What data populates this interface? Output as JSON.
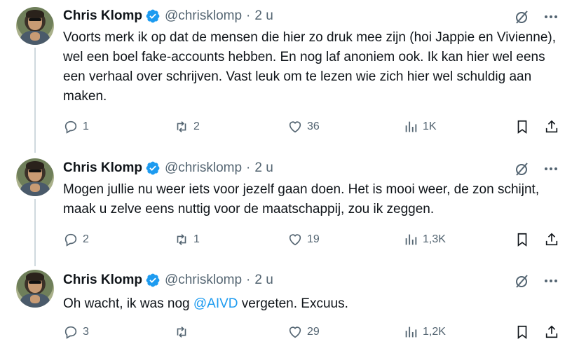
{
  "tweets": [
    {
      "name": "Chris Klomp",
      "handle": "@chrisklomp",
      "separator": "·",
      "time": "2 u",
      "text": "Voorts merk ik op dat de mensen die hier zo druk mee zijn (hoi Jappie en Vivienne), wel een boel fake-accounts hebben. En nog laf anoniem ook. Ik kan hier wel eens een verhaal over schrijven. Vast leuk om te lezen wie zich hier wel schuldig aan maken.",
      "text_before_mention": "",
      "mention": "",
      "text_after_mention": "",
      "replies": "1",
      "reposts": "2",
      "likes": "36",
      "views": "1K"
    },
    {
      "name": "Chris Klomp",
      "handle": "@chrisklomp",
      "separator": "·",
      "time": "2 u",
      "text": "Mogen jullie nu weer iets voor jezelf gaan doen. Het is mooi weer, de zon schijnt, maak u zelve eens nuttig voor de maatschappij, zou ik zeggen.",
      "replies": "2",
      "reposts": "1",
      "likes": "19",
      "views": "1,3K"
    },
    {
      "name": "Chris Klomp",
      "handle": "@chrisklomp",
      "separator": "·",
      "time": "2 u",
      "text_before_mention": "Oh wacht, ik was nog ",
      "mention": "@AIVD",
      "text_after_mention": " vergeten. Excuus.",
      "replies": "3",
      "reposts": "",
      "likes": "29",
      "views": "1,2K"
    }
  ],
  "colors": {
    "verified": "#1d9bf0",
    "muted": "#536471",
    "mention": "#1d9bf0",
    "thread_line": "#cfd9de"
  },
  "icons": [
    "verified-badge-icon",
    "grok-icon",
    "more-icon",
    "reply-icon",
    "repost-icon",
    "like-icon",
    "views-icon",
    "bookmark-icon",
    "share-icon"
  ]
}
